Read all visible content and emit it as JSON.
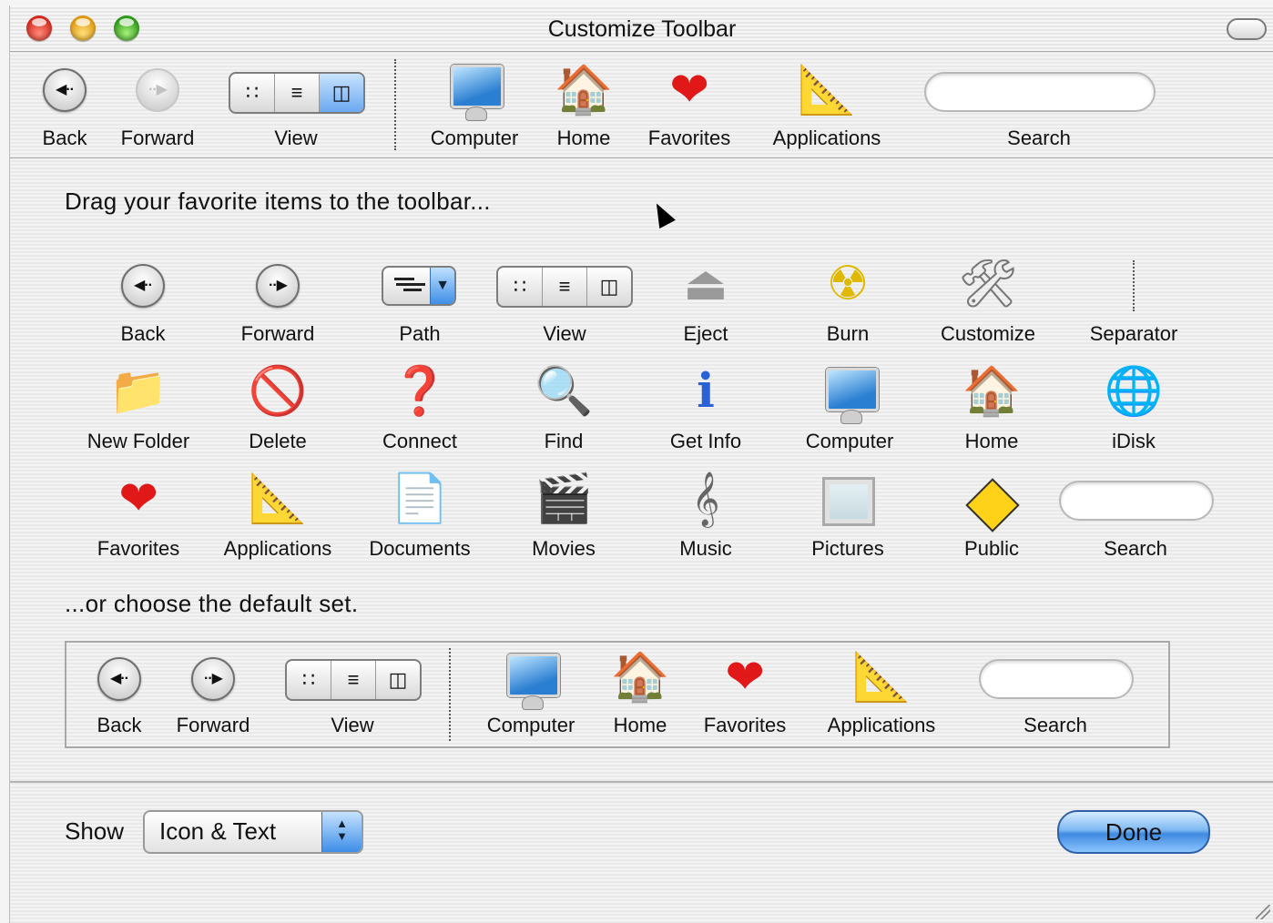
{
  "window": {
    "title": "Customize Toolbar"
  },
  "toolbar": {
    "items": [
      {
        "label": "Back",
        "icon": "back-arrow-icon"
      },
      {
        "label": "Forward",
        "icon": "forward-arrow-icon"
      },
      {
        "label": "View",
        "icon": "view-segmented-icon"
      },
      {
        "label": "Computer",
        "icon": "computer-icon"
      },
      {
        "label": "Home",
        "icon": "home-icon"
      },
      {
        "label": "Favorites",
        "icon": "heart-icon"
      },
      {
        "label": "Applications",
        "icon": "applications-icon"
      },
      {
        "label": "Search",
        "icon": "search-field"
      }
    ]
  },
  "palette": {
    "heading": "Drag your favorite items to the toolbar...",
    "row1": [
      "Back",
      "Forward",
      "Path",
      "View",
      "Eject",
      "Burn",
      "Customize",
      "Separator"
    ],
    "row2": [
      "New Folder",
      "Delete",
      "Connect",
      "Find",
      "Get Info",
      "Computer",
      "Home",
      "iDisk"
    ],
    "row3": [
      "Favorites",
      "Applications",
      "Documents",
      "Movies",
      "Music",
      "Pictures",
      "Public",
      "Search"
    ]
  },
  "default_set": {
    "heading": "...or choose the default set.",
    "items": [
      "Back",
      "Forward",
      "View",
      "Computer",
      "Home",
      "Favorites",
      "Applications",
      "Search"
    ]
  },
  "footer": {
    "show_label": "Show",
    "show_value": "Icon & Text",
    "done_label": "Done"
  },
  "colors": {
    "accent": "#3e8ae0",
    "window_bg": "#eeeeee"
  }
}
